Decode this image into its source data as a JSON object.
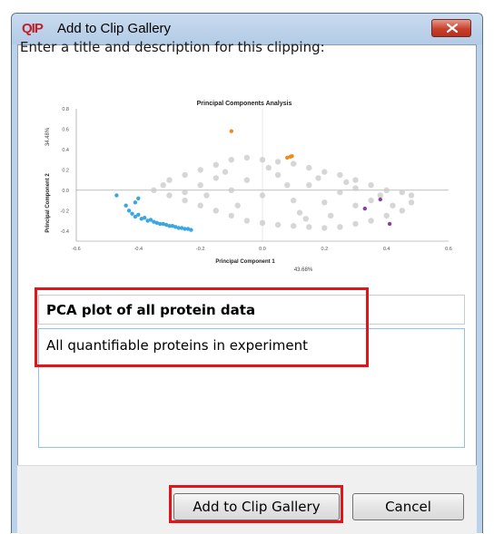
{
  "window": {
    "title": "Add to Clip Gallery",
    "app_icon_text": "QIP"
  },
  "prompt": "Enter a title and description for this clipping:",
  "form": {
    "title_value": "PCA plot of all protein data",
    "description_value": "All quantifiable proteins in experiment"
  },
  "buttons": {
    "add": "Add to Clip Gallery",
    "cancel": "Cancel"
  },
  "colors": {
    "highlight": "#e0161b",
    "series_grey": "#c8c8c8",
    "series_blue": "#3aa6e2",
    "series_orange": "#f08a1c",
    "series_purple": "#8a3fa8"
  },
  "chart_data": {
    "type": "scatter",
    "title": "Principal Components Analysis",
    "xlabel": "Principal Component 1",
    "xlabel_percent": "43.68%",
    "ylabel": "Principal Component 2",
    "ylabel_percent": "34.48%",
    "xlim": [
      -0.6,
      0.6
    ],
    "ylim": [
      -0.5,
      0.8
    ],
    "xticks": [
      "-0.6",
      "-0.4",
      "-0.2",
      "0.0",
      "0.2",
      "0.4",
      "0.6"
    ],
    "yticks": [
      "0.8",
      "0.6",
      "0.4",
      "0.2",
      "0.0",
      "-0.2",
      "-0.4"
    ],
    "grid": false,
    "legend": "none",
    "series": [
      {
        "color": "#f08a1c",
        "points": [
          [
            -0.1,
            0.58
          ],
          [
            0.08,
            0.32
          ],
          [
            0.09,
            0.33
          ],
          [
            0.095,
            0.335
          ]
        ]
      },
      {
        "color": "#8a3fa8",
        "points": [
          [
            0.38,
            -0.09
          ],
          [
            0.33,
            -0.18
          ],
          [
            0.41,
            -0.33
          ]
        ]
      },
      {
        "color": "#3aa6e2",
        "points": [
          [
            -0.47,
            -0.05
          ],
          [
            -0.44,
            -0.15
          ],
          [
            -0.43,
            -0.2
          ],
          [
            -0.42,
            -0.23
          ],
          [
            -0.41,
            -0.26
          ],
          [
            -0.4,
            -0.24
          ],
          [
            -0.39,
            -0.28
          ],
          [
            -0.38,
            -0.27
          ],
          [
            -0.37,
            -0.3
          ],
          [
            -0.36,
            -0.29
          ],
          [
            -0.35,
            -0.31
          ],
          [
            -0.34,
            -0.32
          ],
          [
            -0.33,
            -0.33
          ],
          [
            -0.32,
            -0.33
          ],
          [
            -0.31,
            -0.34
          ],
          [
            -0.3,
            -0.35
          ],
          [
            -0.29,
            -0.35
          ],
          [
            -0.28,
            -0.36
          ],
          [
            -0.27,
            -0.37
          ],
          [
            -0.26,
            -0.37
          ],
          [
            -0.25,
            -0.38
          ],
          [
            -0.24,
            -0.38
          ],
          [
            -0.23,
            -0.39
          ],
          [
            -0.4,
            -0.08
          ],
          [
            -0.41,
            -0.12
          ]
        ]
      },
      {
        "color": "#c8c8c8",
        "points": [
          [
            -0.3,
            0.1
          ],
          [
            -0.25,
            0.15
          ],
          [
            -0.2,
            0.2
          ],
          [
            -0.15,
            0.25
          ],
          [
            -0.1,
            0.3
          ],
          [
            -0.05,
            0.32
          ],
          [
            0.0,
            0.3
          ],
          [
            0.05,
            0.28
          ],
          [
            0.1,
            0.26
          ],
          [
            0.15,
            0.22
          ],
          [
            0.2,
            0.18
          ],
          [
            0.25,
            0.15
          ],
          [
            0.3,
            0.1
          ],
          [
            0.35,
            0.05
          ],
          [
            0.4,
            0.0
          ],
          [
            0.45,
            -0.02
          ],
          [
            0.48,
            -0.05
          ],
          [
            -0.35,
            0.0
          ],
          [
            -0.3,
            -0.05
          ],
          [
            -0.25,
            -0.1
          ],
          [
            -0.2,
            -0.15
          ],
          [
            -0.15,
            -0.2
          ],
          [
            -0.1,
            -0.25
          ],
          [
            -0.05,
            -0.3
          ],
          [
            0.0,
            -0.32
          ],
          [
            0.05,
            -0.34
          ],
          [
            0.1,
            -0.35
          ],
          [
            0.15,
            -0.36
          ],
          [
            0.2,
            -0.37
          ],
          [
            0.25,
            -0.36
          ],
          [
            0.3,
            -0.33
          ],
          [
            0.35,
            -0.3
          ],
          [
            0.4,
            -0.25
          ],
          [
            0.45,
            -0.2
          ],
          [
            0.48,
            -0.12
          ],
          [
            -0.2,
            0.05
          ],
          [
            -0.1,
            0.0
          ],
          [
            0.0,
            -0.05
          ],
          [
            0.1,
            -0.1
          ],
          [
            0.2,
            -0.12
          ],
          [
            0.3,
            -0.15
          ],
          [
            -0.15,
            0.12
          ],
          [
            0.05,
            0.15
          ],
          [
            0.15,
            0.05
          ],
          [
            0.25,
            -0.02
          ],
          [
            -0.05,
            0.1
          ],
          [
            0.35,
            -0.1
          ],
          [
            -0.25,
            -0.02
          ],
          [
            0.12,
            -0.22
          ],
          [
            -0.08,
            -0.15
          ],
          [
            0.22,
            -0.25
          ],
          [
            0.3,
            0.02
          ],
          [
            0.42,
            -0.15
          ],
          [
            -0.32,
            0.05
          ],
          [
            0.02,
            0.22
          ],
          [
            0.18,
            0.12
          ],
          [
            -0.12,
            0.18
          ],
          [
            0.27,
            0.08
          ],
          [
            0.38,
            -0.05
          ],
          [
            -0.18,
            -0.05
          ],
          [
            0.08,
            0.05
          ],
          [
            0.14,
            -0.28
          ]
        ]
      }
    ]
  }
}
